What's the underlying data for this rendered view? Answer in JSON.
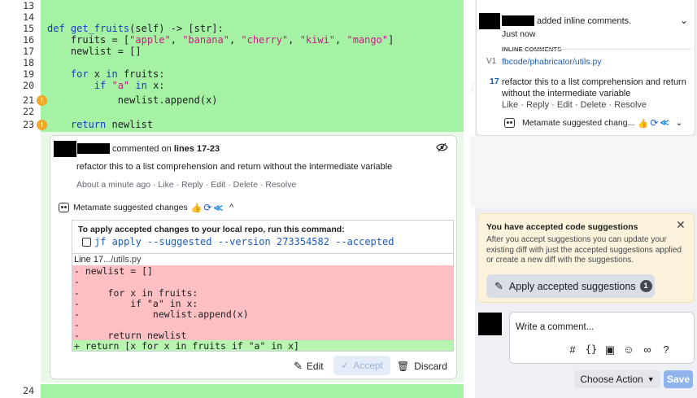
{
  "editor": {
    "line_numbers": [
      "13",
      "14",
      "15",
      "16",
      "17",
      "18",
      "19",
      "20",
      "21",
      "22",
      "23",
      "24"
    ],
    "code": {
      "l15_kw": "def ",
      "l15_fn": "get_fruits",
      "l15_rest": "(self) -> [str]:",
      "l16_pre": "    fruits = [",
      "l16_s1": "\"apple\"",
      "l16_s2": "\"banana\"",
      "l16_s3": "\"cherry\"",
      "l16_s4": "\"kiwi\"",
      "l16_s5": "\"mango\"",
      "l17": "    newlist = []",
      "l19_kw": "    for ",
      "l19_mid": "x ",
      "l19_kw2": "in ",
      "l19_rest": "fruits:",
      "l20_kw": "        if ",
      "l20_str": "\"a\" ",
      "l20_kw2": "in ",
      "l20_rest": "x:",
      "l21": "            newlist.append(x)",
      "l23_kw": "    return ",
      "l23_rest": "newlist"
    },
    "warning_glyph": "!"
  },
  "inline_comment": {
    "header_suffix": "commented on",
    "line_range": "lines 17-23",
    "body": "refactor this to a list comprehension and return without the intermediate variable",
    "timestamp": "About a minute ago",
    "actions": [
      "Like",
      "Reply",
      "Edit",
      "Delete",
      "Resolve"
    ],
    "separator": "·",
    "metamate_label": "Metamate suggested changes",
    "apply_instruction": "To apply accepted changes to your local repo, run this command:",
    "command": "jf apply --suggested --version 273354582 --accepted",
    "diff_header_line": "Line 17",
    "diff_header_path": ".../utils.py",
    "diff_removed": [
      "- newlist = []",
      "-",
      "-     for x in fruits:",
      "-         if \"a\" in x:",
      "-             newlist.append(x)",
      "-",
      "-     return newlist"
    ],
    "diff_added": "+ return [x for x in fruits if \"a\" in x]",
    "edit_label": "Edit",
    "accept_label": "Accept",
    "discard_label": "Discard"
  },
  "activity": {
    "added_text": "added inline comments.",
    "time": "Just now",
    "section_label": "INLINE COMMENTS",
    "version_tag": "V1",
    "file_path": "fbcode/phabricator/utils.py",
    "comment_line": "17",
    "comment_text": "refactor this to a list comprehension and return without the intermediate variable",
    "actions": [
      "Like",
      "Reply",
      "Edit",
      "Delete",
      "Resolve"
    ],
    "separator": "·",
    "metamate_label": "Metamate suggested chang..."
  },
  "notice": {
    "title": "You have accepted code suggestions",
    "body": "After you accept suggestions you can update your existing diff with just the accepted suggestions applied or create a new diff with the suggestions.",
    "button_label": "Apply accepted suggestions",
    "count": "1"
  },
  "composer": {
    "placeholder": "Write a comment...",
    "choose_action": "Choose Action",
    "save": "Save"
  },
  "colors": {
    "added_bg": "#a6f2a4",
    "removed_bg": "#ffc0c3",
    "link": "#1d5bbf",
    "warning": "#f0a826"
  }
}
